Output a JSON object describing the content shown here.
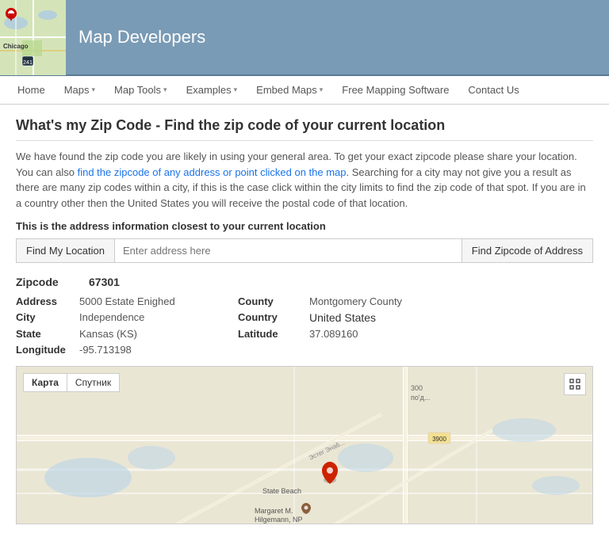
{
  "header": {
    "brand_title": "Map Developers",
    "chicago_label": "Chicago"
  },
  "nav": {
    "items": [
      {
        "label": "Home",
        "has_arrow": false
      },
      {
        "label": "Maps",
        "has_arrow": true
      },
      {
        "label": "Map Tools",
        "has_arrow": true
      },
      {
        "label": "Examples",
        "has_arrow": true
      },
      {
        "label": "Embed Maps",
        "has_arrow": true
      },
      {
        "label": "Free Mapping Software",
        "has_arrow": false
      },
      {
        "label": "Contact Us",
        "has_arrow": false
      }
    ]
  },
  "page": {
    "title": "What's my Zip Code - Find the zip code of your current location",
    "description_p1": "We have found the zip code you are likely in using your general area. To get your exact zipcode please share your location. You can also find the zipcode of any address or point clicked on the map. Searching for a city may not give you a result as there are many zip codes within a city, if this is the case click within the city limits to find the zip code of that spot. If you are in a country other then the United States you will receive the postal code of that location.",
    "section_label": "This is the address information closest to your current location",
    "find_location_btn": "Find My Location",
    "address_placeholder": "Enter address here",
    "find_zip_btn": "Find Zipcode of Address",
    "zipcode_label": "Zipcode",
    "zipcode_value": "67301",
    "fields": {
      "address_label": "Address",
      "address_value": "5000 Estate Enighed",
      "city_label": "City",
      "city_value": "Independence",
      "state_label": "State",
      "state_value": "Kansas (KS)",
      "longitude_label": "Longitude",
      "longitude_value": "-95.713198",
      "county_label": "County",
      "county_value": "Montgomery County",
      "country_label": "Country",
      "country_value": "United States",
      "latitude_label": "Latitude",
      "latitude_value": "37.089160"
    },
    "map_controls": {
      "btn1": "Карта",
      "btn2": "Спутник"
    }
  }
}
